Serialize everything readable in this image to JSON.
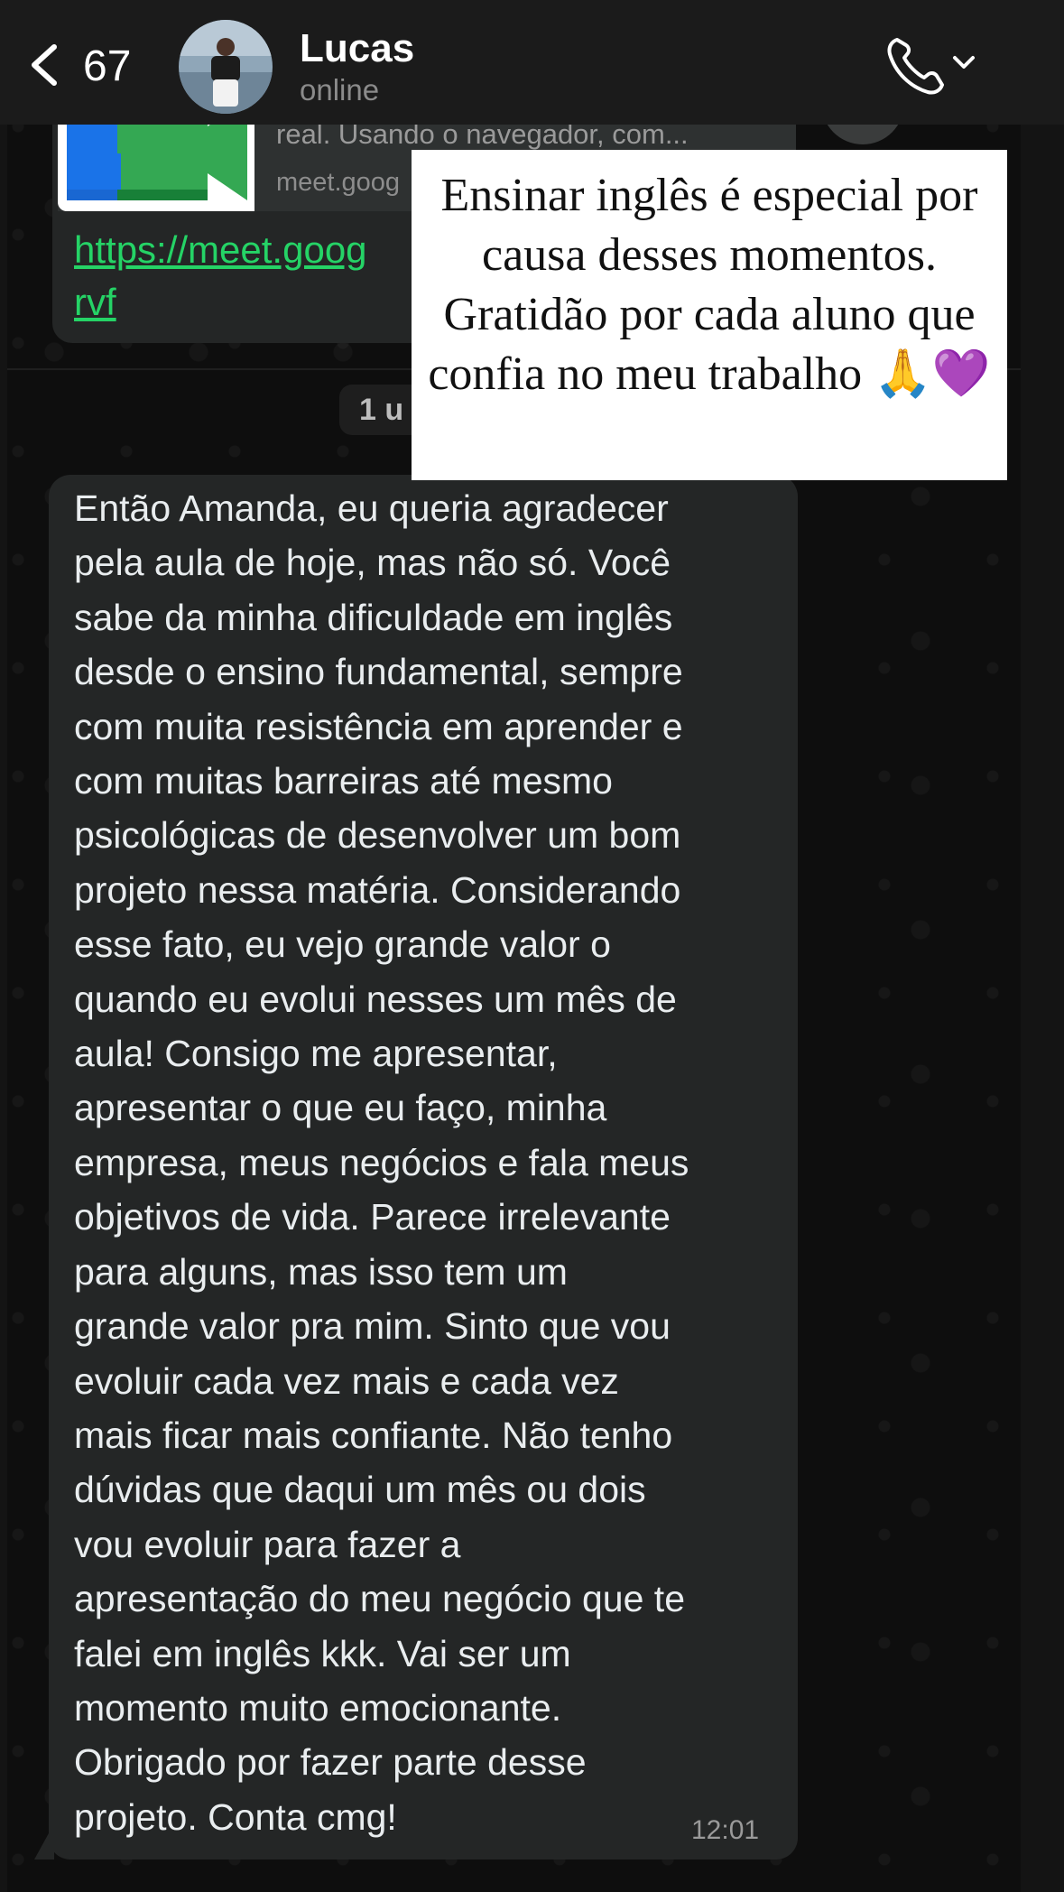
{
  "header": {
    "unread_count": "67",
    "contact_name": "Lucas",
    "contact_status": "online"
  },
  "previous_message": {
    "preview_description": "real. Usando o navegador, com...",
    "preview_domain": "meet.goog",
    "link_text": "https://meet.goog\nrvf"
  },
  "date_divider": "1 u",
  "overlay_caption": "Ensinar inglês é especial por causa desses momentos. Gratidão por cada aluno que confia no meu trabalho 🙏💜",
  "message": {
    "text": "Então Amanda, eu queria agradecer\npela aula de hoje, mas não só. Você\nsabe da minha dificuldade em inglês\ndesde o ensino fundamental, sempre\ncom muita resistência em aprender e\ncom muitas barreiras até mesmo\npsicológicas de desenvolver um bom\nprojeto nessa matéria. Considerando\nesse fato, eu vejo grande valor o\nquando eu evolui nesses um mês de\naula! Consigo me apresentar,\napresentar o que eu faço, minha\nempresa, meus negócios e fala meus\nobjetivos de vida. Parece irrelevante\npara alguns, mas isso tem um\ngrande valor pra mim. Sinto que vou\nevoluir cada vez mais e cada vez\nmais ficar mais confiante. Não tenho\ndúvidas que daqui um mês ou dois\nvou evoluir para fazer a\napresentação do meu negócio que te\nfalei em inglês kkk. Vai ser um\nmomento muito emocionante.\nObrigado por fazer parte desse\nprojeto. Conta cmg!",
    "time": "12:01"
  },
  "colors": {
    "header_bg": "#1b1b1b",
    "bubble_bg": "#242626",
    "link_color": "#25d366",
    "overlay_bg": "#ffffff"
  },
  "icons": {
    "back": "chevron-left-icon",
    "call": "phone-icon",
    "dropdown": "chevron-down-icon",
    "meet": "google-meet-icon"
  }
}
